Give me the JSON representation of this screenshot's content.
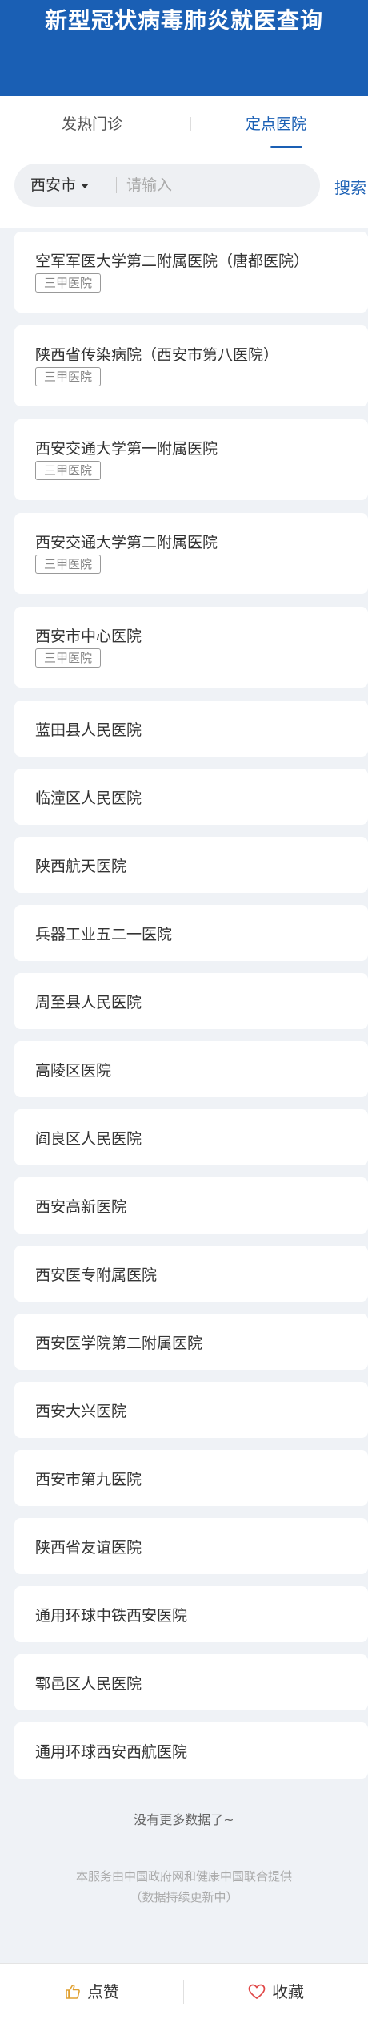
{
  "header": {
    "title": "新型冠状病毒肺炎就医查询"
  },
  "tabs": [
    {
      "label": "发热门诊",
      "active": false
    },
    {
      "label": "定点医院",
      "active": true
    }
  ],
  "search": {
    "city": "西安市",
    "placeholder": "请输入",
    "button": "搜索"
  },
  "hospitals": [
    {
      "name": "空军军医大学第二附属医院（唐都医院）",
      "tag": "三甲医院"
    },
    {
      "name": "陕西省传染病院（西安市第八医院）",
      "tag": "三甲医院"
    },
    {
      "name": "西安交通大学第一附属医院",
      "tag": "三甲医院"
    },
    {
      "name": "西安交通大学第二附属医院",
      "tag": "三甲医院"
    },
    {
      "name": "西安市中心医院",
      "tag": "三甲医院"
    },
    {
      "name": "蓝田县人民医院"
    },
    {
      "name": "临潼区人民医院"
    },
    {
      "name": "陕西航天医院"
    },
    {
      "name": "兵器工业五二一医院"
    },
    {
      "name": "周至县人民医院"
    },
    {
      "name": "高陵区医院"
    },
    {
      "name": "阎良区人民医院"
    },
    {
      "name": "西安高新医院"
    },
    {
      "name": "西安医专附属医院"
    },
    {
      "name": "西安医学院第二附属医院"
    },
    {
      "name": "西安大兴医院"
    },
    {
      "name": "西安市第九医院"
    },
    {
      "name": "陕西省友谊医院"
    },
    {
      "name": "通用环球中铁西安医院"
    },
    {
      "name": "鄠邑区人民医院"
    },
    {
      "name": "通用环球西安西航医院"
    }
  ],
  "footer": {
    "no_more": "没有更多数据了~",
    "provider_line1": "本服务由中国政府网和健康中国联合提供",
    "provider_line2": "（数据持续更新中）"
  },
  "bottom_bar": {
    "like_label": "点赞",
    "favorite_label": "收藏"
  },
  "colors": {
    "brand_blue": "#1a5fb4",
    "like_icon": "#e0a030",
    "favorite_icon": "#e04848"
  }
}
